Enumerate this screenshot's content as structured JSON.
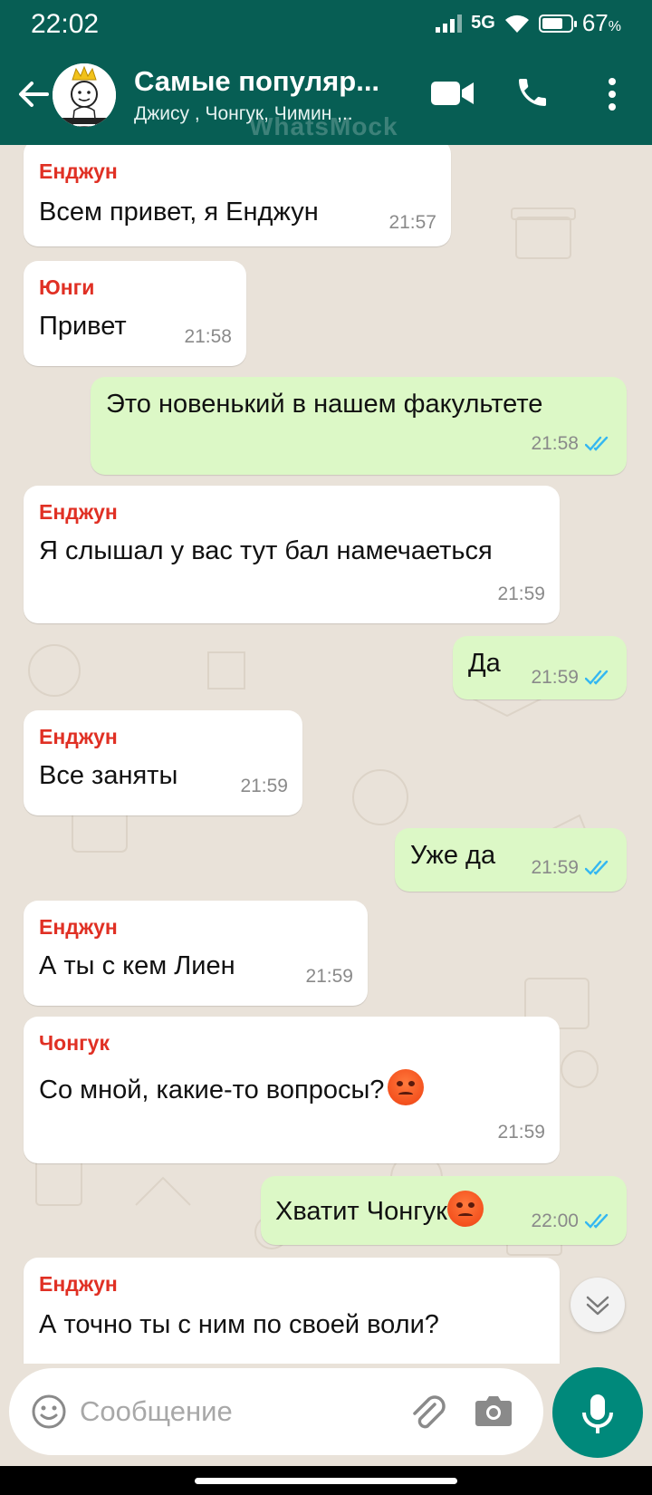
{
  "status_bar": {
    "time": "22:02",
    "network": "5G",
    "battery": "67",
    "battery_unit": "%"
  },
  "header": {
    "title": "Самые популяр...",
    "subtitle": "Джису , Чонгук, Чимин ,..",
    "watermark": "WhatsMock"
  },
  "messages": [
    {
      "dir": "in",
      "sender": "Енджун",
      "text": "Всем привет, я Енджун",
      "time": "21:57"
    },
    {
      "dir": "in",
      "sender": "Юнги",
      "text": "Привет",
      "time": "21:58"
    },
    {
      "dir": "out",
      "text": "Это новенький в нашем факультете",
      "time": "21:58"
    },
    {
      "dir": "in",
      "sender": "Енджун",
      "text": "Я слышал у вас тут бал намечаеться",
      "time": "21:59"
    },
    {
      "dir": "out",
      "text": "Да",
      "time": "21:59"
    },
    {
      "dir": "in",
      "sender": "Енджун",
      "text": "Все заняты",
      "time": "21:59"
    },
    {
      "dir": "out",
      "text": "Уже да",
      "time": "21:59"
    },
    {
      "dir": "in",
      "sender": "Енджун",
      "text": "А ты с кем Лиен",
      "time": "21:59"
    },
    {
      "dir": "in",
      "sender": "Чонгук",
      "text": "Со мной, какие-то вопросы?",
      "emoji": "angry-face",
      "time": "21:59"
    },
    {
      "dir": "out",
      "text": "Хватит Чонгук",
      "emoji": "angry-face",
      "time": "22:00"
    },
    {
      "dir": "in",
      "sender": "Енджун",
      "text": "А точно ты с ним по своей воли?",
      "time": ""
    }
  ],
  "input": {
    "placeholder": "Сообщение"
  },
  "colors": {
    "header": "#075e54",
    "outgoing": "#dcf8c6",
    "sender": "#e03024",
    "read_ticks": "#34b7f1",
    "mic": "#00897b"
  },
  "icons": [
    "back-arrow-icon",
    "video-call-icon",
    "phone-icon",
    "more-vert-icon",
    "emoji-icon",
    "attach-icon",
    "camera-icon",
    "mic-icon",
    "chevron-down-icon",
    "double-check-icon"
  ]
}
